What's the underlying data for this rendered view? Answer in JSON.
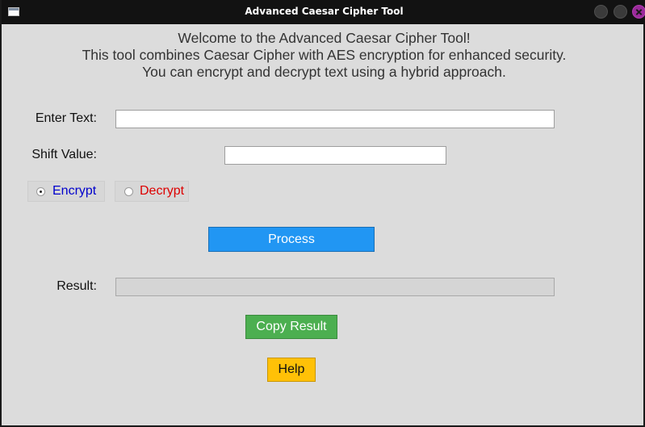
{
  "window": {
    "title": "Advanced Caesar Cipher Tool"
  },
  "welcome": {
    "line1": "Welcome to the Advanced Caesar Cipher Tool!",
    "line2": "This tool combines Caesar Cipher with AES encryption for enhanced security.",
    "line3": "You can encrypt and decrypt text using a hybrid approach."
  },
  "form": {
    "text_label": "Enter Text:",
    "text_value": "",
    "shift_label": "Shift Value:",
    "shift_value": "",
    "result_label": "Result:",
    "result_value": ""
  },
  "mode": {
    "selected": "Encrypt",
    "encrypt_label": "Encrypt",
    "decrypt_label": "Decrypt",
    "encrypt_color": "#0000cc",
    "decrypt_color": "#dd0000"
  },
  "buttons": {
    "process_label": "Process",
    "copy_label": "Copy Result",
    "help_label": "Help",
    "process_color": "#2196f3",
    "copy_color": "#4caf50",
    "help_color": "#ffc107"
  },
  "icons": {
    "app": "window-icon",
    "minimize": "minimize-icon",
    "maximize": "maximize-icon",
    "close": "close-icon"
  }
}
